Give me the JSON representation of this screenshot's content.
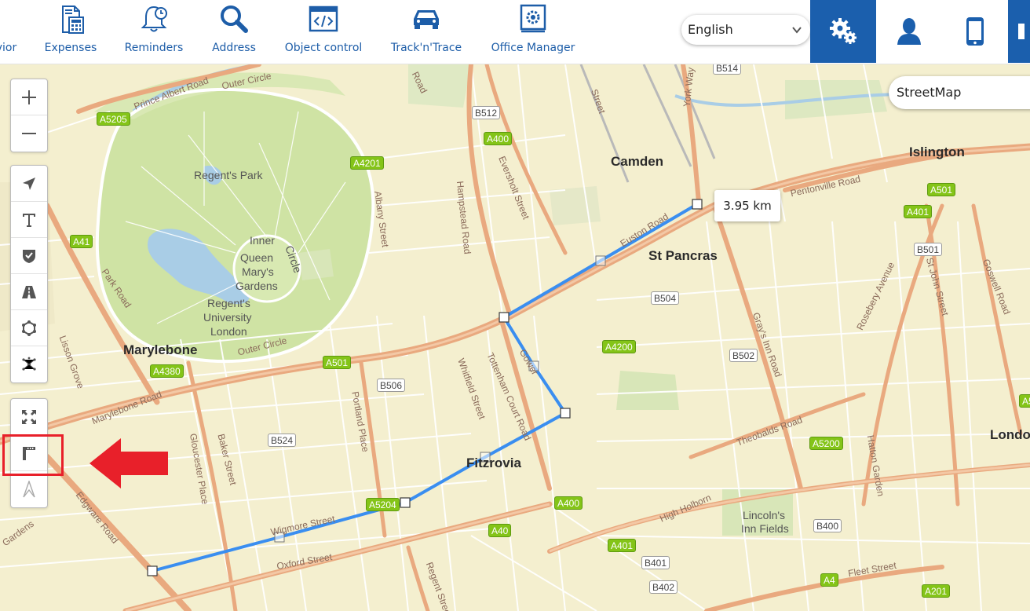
{
  "nav": {
    "items": [
      {
        "label": "vior",
        "icon": "behavior-icon"
      },
      {
        "label": "Expenses",
        "icon": "calculator-icon"
      },
      {
        "label": "Reminders",
        "icon": "bell-clock-icon"
      },
      {
        "label": "Address",
        "icon": "magnifier-icon"
      },
      {
        "label": "Object control",
        "icon": "code-window-icon"
      },
      {
        "label": "Track'n'Trace",
        "icon": "car-icon"
      },
      {
        "label": "Office Manager",
        "icon": "office-gear-icon"
      }
    ],
    "language": "English",
    "buttons": [
      "settings-icon",
      "user-icon",
      "mobile-icon"
    ]
  },
  "map": {
    "layer": "StreetMap",
    "distance_label": "3.95 km",
    "places": {
      "camden": "Camden",
      "st_pancras": "St Pancras",
      "islington": "Islington",
      "marylebone": "Marylebone",
      "fitzrovia": "Fitzrovia",
      "london": "Londo"
    },
    "minor_places": {
      "regents_park": "Regent's Park",
      "inner": "Inner",
      "circle": "Circle",
      "queen": "Queen",
      "marys": "Mary's",
      "gardens": "Gardens",
      "regents": "Regent's",
      "university": "University",
      "london_u": "London",
      "lincolns": "Lincoln's",
      "inn_fields": "Inn Fields"
    },
    "roads": {
      "prince_albert_road": "Prince Albert Road",
      "outer_circle_top": "Outer Circle",
      "outer_circle_bottom": "Outer Circle",
      "park_road": "Park Road",
      "marylebone_road": "Marylebone Road",
      "gloucester_place": "Gloucester Place",
      "baker_street": "Baker Street",
      "edgware_road": "Edgware Road",
      "albany_street": "Albany Street",
      "hampstead_road": "Hampstead Road",
      "eversholt_street": "Eversholt Street",
      "euston_road": "Euston Road",
      "pentonville_road": "Pentonville Road",
      "tottenham_court_road": "Tottenham Court Road",
      "whitfield_street": "Whitfield Street",
      "portland_place": "Portland Place",
      "wigmore_street": "Wigmore Street",
      "oxford_street": "Oxford Street",
      "grays_inn_road": "Gray's Inn Road",
      "theobalds_road": "Theobalds Road",
      "high_holborn": "High Holborn",
      "rosebery_avenue": "Rosebery Avenue",
      "st_john_street": "St John Street",
      "goswell_road": "Goswell Road",
      "fleet_street": "Fleet Street",
      "regent_street": "Regent Street",
      "hatton_garden": "Hatton Garden",
      "york_way": "York Way",
      "gower": "Gower",
      "road_top": "Road",
      "london_grove": "Lisson Grove",
      "gardens_left": "Gardens",
      "st_street_top": "Street"
    },
    "badges_a": [
      "A5205",
      "A400",
      "A4201",
      "A41",
      "A501",
      "A4380",
      "A4200",
      "A501",
      "A401",
      "A5200",
      "A400",
      "A5204",
      "A40",
      "A401",
      "A4",
      "A201",
      "A5"
    ],
    "badges_b": [
      "B514",
      "B512",
      "B504",
      "B501",
      "B502",
      "B506",
      "B524",
      "B400",
      "B401",
      "B402"
    ]
  },
  "toolbar": {
    "zoom": [
      "zoom-in-icon",
      "zoom-out-icon"
    ],
    "tools": [
      "navigate-icon",
      "text-icon",
      "shield-icon",
      "road-icon",
      "polygon-icon",
      "cluster-icon"
    ],
    "measure": [
      "fullscreen-icon",
      "ruler-icon",
      "compass-icon"
    ]
  }
}
